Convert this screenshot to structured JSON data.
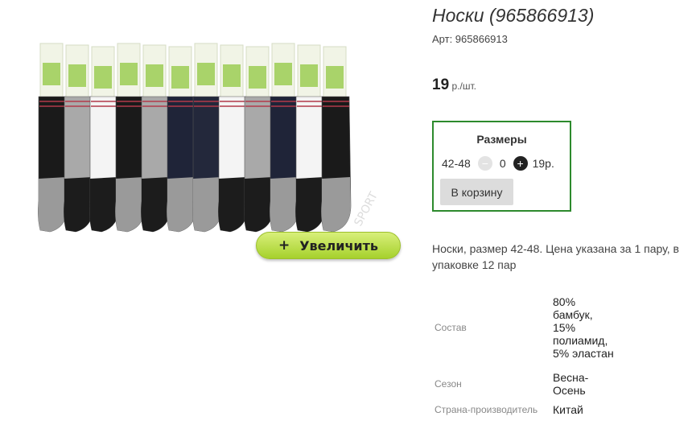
{
  "product": {
    "title": "Носки (965866913)",
    "sku_label": "Арт: 965866913",
    "price_value": "19",
    "price_unit": " р./шт.",
    "zoom_label": "Увеличить",
    "description": "Носки, размер 42-48. Цена указана за 1 пару, в упаковке 12 пар",
    "image_brand_text": "SPORT"
  },
  "sizes": {
    "title": "Размеры",
    "items": [
      {
        "size": "42-48",
        "quantity": "0",
        "price": "19р."
      }
    ],
    "cart_button": "В корзину"
  },
  "specs": [
    {
      "name": "Состав",
      "value": "80% бамбук, 15% полиамид, 5% эластан"
    },
    {
      "name": "Сезон",
      "value": "Весна-Осень"
    },
    {
      "name": "Страна-производитель",
      "value": "Китай"
    }
  ],
  "sock_colors": [
    "#1a1a1a",
    "#a9a9a9",
    "#f4f4f4",
    "#1a1a1a",
    "#a9a9a9",
    "#1f2438",
    "#23283b",
    "#f4f4f4",
    "#a9a9a9",
    "#1f2438",
    "#f4f4f4",
    "#1a1a1a"
  ]
}
